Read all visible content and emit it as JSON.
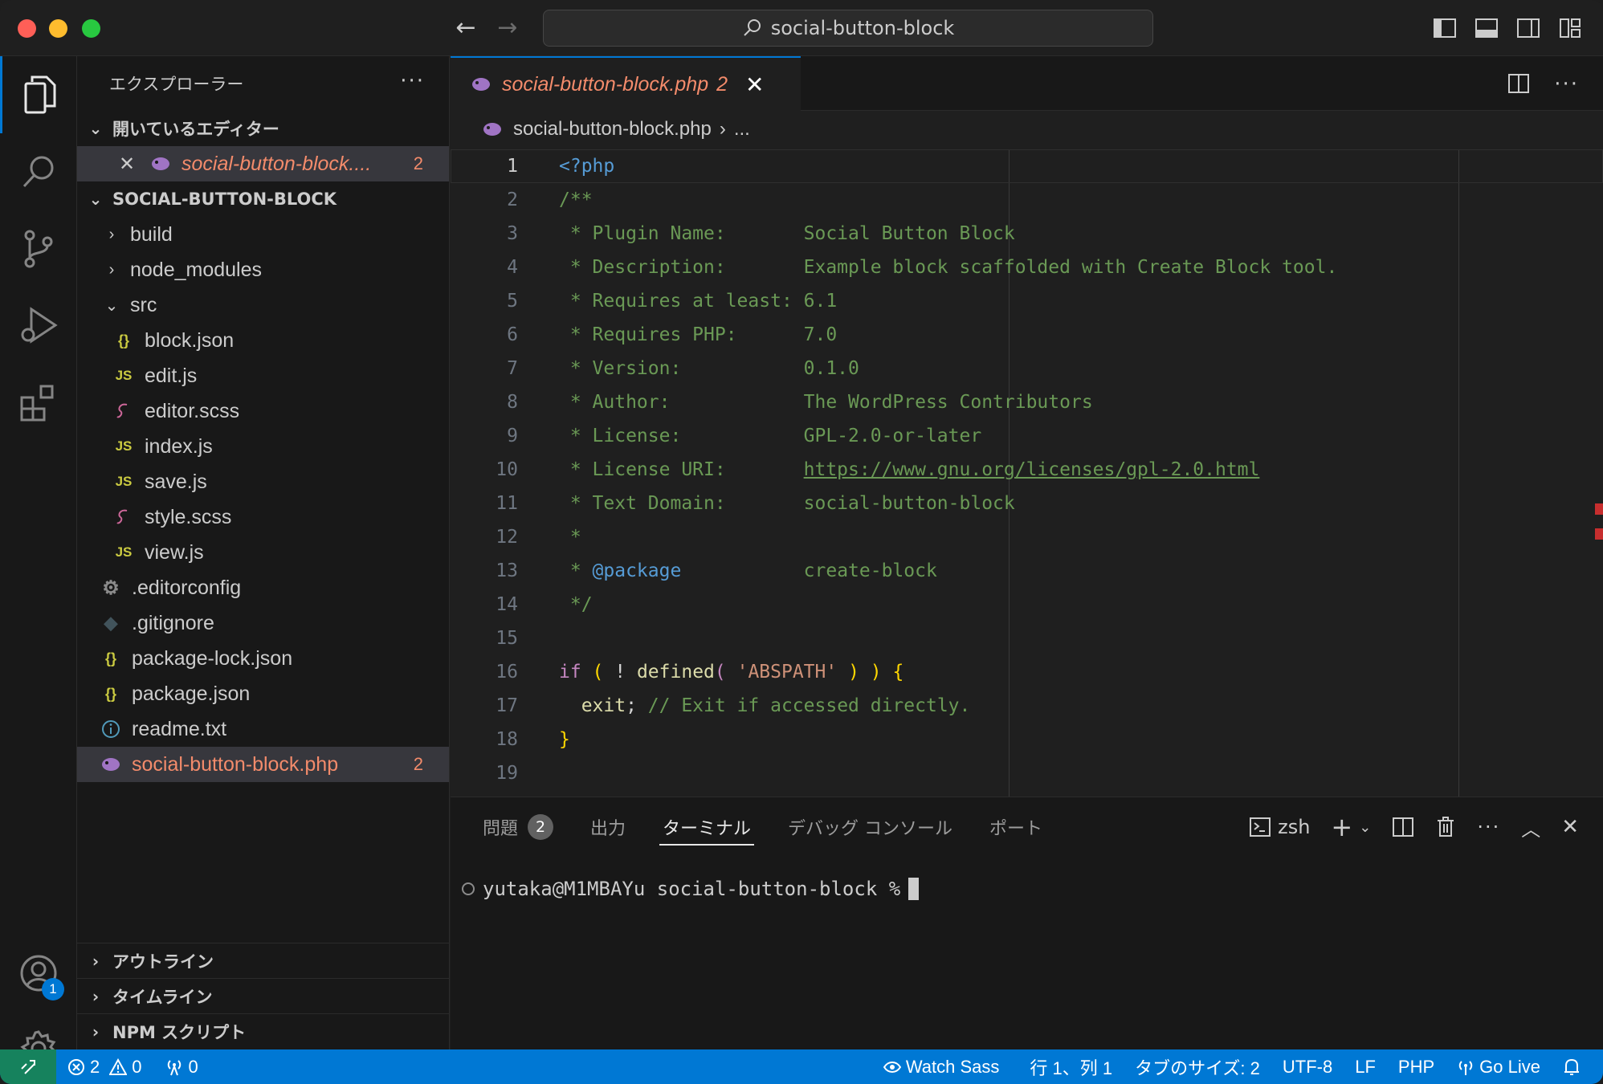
{
  "titlebar": {
    "search_text": "social-button-block"
  },
  "activity": {
    "accounts_badge": "1"
  },
  "sidebar": {
    "title": "エクスプローラー",
    "more": "···",
    "open_editors_title": "開いているエディター",
    "open_editor": {
      "name": "social-button-block....",
      "count": "2"
    },
    "project_title": "SOCIAL-BUTTON-BLOCK",
    "folders": [
      {
        "name": "build"
      },
      {
        "name": "node_modules"
      },
      {
        "name": "src"
      }
    ],
    "src_files": [
      {
        "name": "block.json",
        "icon": "{}"
      },
      {
        "name": "edit.js",
        "icon": "JS"
      },
      {
        "name": "editor.scss",
        "icon": "sass"
      },
      {
        "name": "index.js",
        "icon": "JS"
      },
      {
        "name": "save.js",
        "icon": "JS"
      },
      {
        "name": "style.scss",
        "icon": "sass"
      },
      {
        "name": "view.js",
        "icon": "JS"
      }
    ],
    "root_files": [
      {
        "name": ".editorconfig",
        "icon": "gear"
      },
      {
        "name": ".gitignore",
        "icon": "git"
      },
      {
        "name": "package-lock.json",
        "icon": "{}"
      },
      {
        "name": "package.json",
        "icon": "{}"
      },
      {
        "name": "readme.txt",
        "icon": "info"
      }
    ],
    "php_file": {
      "name": "social-button-block.php",
      "count": "2"
    },
    "outline_title": "アウトライン",
    "timeline_title": "タイムライン",
    "npm_title": "NPM スクリプト"
  },
  "editor": {
    "tab": {
      "name": "social-button-block.php",
      "count": "2",
      "close": "✕"
    },
    "breadcrumb": {
      "file": "social-button-block.php",
      "sep": "›",
      "rest": "..."
    },
    "lines": [
      "1",
      "2",
      "3",
      "4",
      "5",
      "6",
      "7",
      "8",
      "9",
      "10",
      "11",
      "12",
      "13",
      "14",
      "15",
      "16",
      "17",
      "18",
      "19"
    ],
    "code": {
      "l1": "<?php",
      "l2": "/**",
      "l3": " * Plugin Name:       Social Button Block",
      "l4": " * Description:       Example block scaffolded with Create Block tool.",
      "l5": " * Requires at least: 6.1",
      "l6": " * Requires PHP:      7.0",
      "l7": " * Version:           0.1.0",
      "l8": " * Author:            The WordPress Contributors",
      "l9": " * License:           GPL-2.0-or-later",
      "l10_prefix": " * License URI:       ",
      "l10_link": "https://www.gnu.org/licenses/gpl-2.0.html",
      "l11": " * Text Domain:       social-button-block",
      "l12": " *",
      "l13_prefix": " * ",
      "l13_tag": "@package",
      "l13_rest": "           create-block",
      "l14": " */",
      "l16_if": "if",
      "l16_p1": " ( ",
      "l16_not": "! ",
      "l16_fn": "defined",
      "l16_p2": "( ",
      "l16_str": "'ABSPATH'",
      "l16_p3": " ) ) {",
      "l17_exit": "  exit",
      "l17_semi": "; ",
      "l17_comment": "// Exit if accessed directly.",
      "l18": "}"
    }
  },
  "panel": {
    "tabs": [
      {
        "label": "問題",
        "badge": "2"
      },
      {
        "label": "出力"
      },
      {
        "label": "ターミナル"
      },
      {
        "label": "デバッグ コンソール"
      },
      {
        "label": "ポート"
      }
    ],
    "shell": "zsh",
    "prompt": "yutaka@M1MBAYu social-button-block % "
  },
  "statusbar": {
    "errors": "2",
    "warnings": "0",
    "ports": "0",
    "watch_sass": "Watch Sass",
    "position": "行 1、列 1",
    "tab_size": "タブのサイズ: 2",
    "encoding": "UTF-8",
    "eol": "LF",
    "language": "PHP",
    "go_live": "Go Live"
  },
  "colors": {
    "accent": "#0078d4",
    "remote": "#16825d",
    "error_file": "#f38b6b"
  }
}
